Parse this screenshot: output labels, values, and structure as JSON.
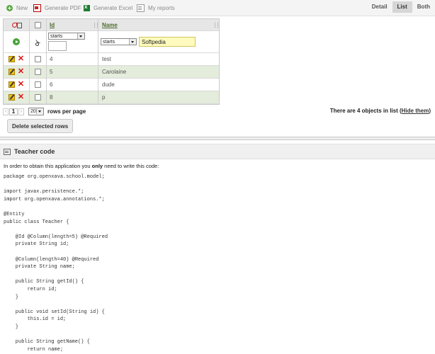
{
  "toolbar": {
    "new": "New",
    "pdf": "Generate PDF",
    "excel": "Generate Excel",
    "reports": "My reports"
  },
  "view_tabs": [
    "Detail",
    "List",
    "Both"
  ],
  "active_view": "List",
  "table": {
    "columns": [
      "Id",
      "Name"
    ],
    "filters": {
      "id": {
        "operator": "starts",
        "value": ""
      },
      "name": {
        "operator": "starts",
        "value": "Softpedia"
      }
    },
    "rows": [
      {
        "id": "4",
        "name": "test"
      },
      {
        "id": "5",
        "name": "Carolaine"
      },
      {
        "id": "6",
        "name": "dude"
      },
      {
        "id": "8",
        "name": "p"
      }
    ]
  },
  "pager": {
    "prev": "‹",
    "page": "1",
    "next": "›",
    "page_size": "20",
    "rows_per_page": "rows per page"
  },
  "status": {
    "text": "There are 4 objects in list (",
    "hide_link": "Hide them",
    "close": ")"
  },
  "delete_button": "Delete selected rows",
  "section": {
    "title": "Teacher code",
    "intro_before": "In order to obtain this application you ",
    "intro_bold": "only",
    "intro_after": " need to write this code:",
    "code": "package org.openxava.school.model;\n\nimport javax.persistence.*;\nimport org.openxava.annotations.*;\n\n@Entity\npublic class Teacher {\n\n    @Id @Column(length=5) @Required\n    private String id;\n\n    @Column(length=40) @Required\n    private String name;\n\n    public String getId() {\n        return id;\n    }\n\n    public void setId(String id) {\n        this.id = id;\n    }\n\n    public String getName() {\n        return name;"
  }
}
